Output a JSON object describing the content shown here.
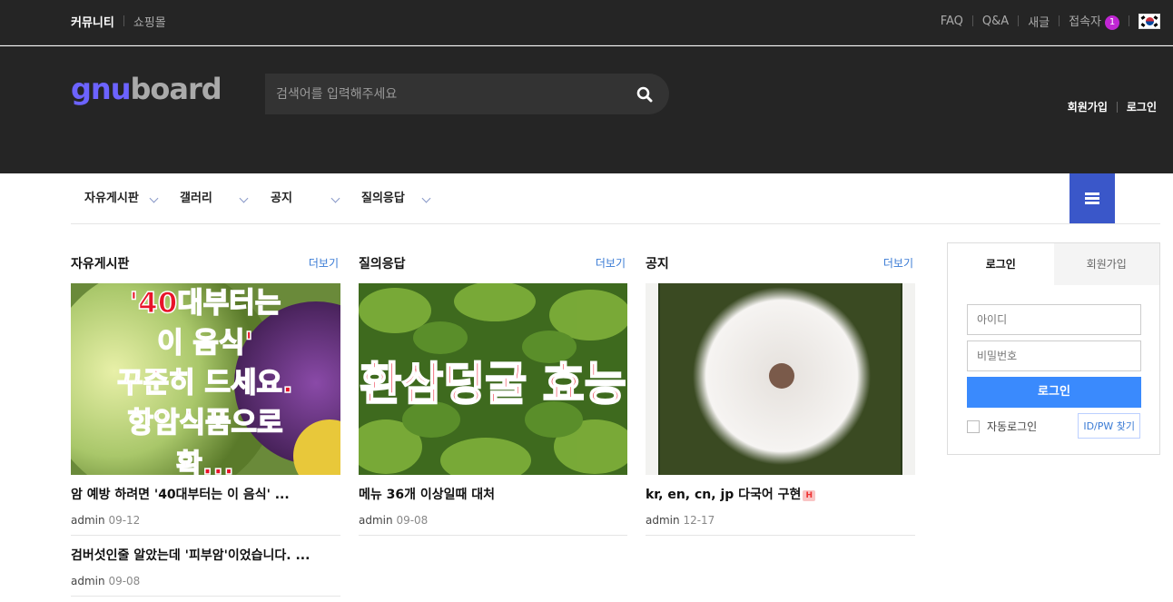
{
  "topbar": {
    "community": "커뮤니티",
    "shop": "쇼핑몰",
    "faq": "FAQ",
    "qa": "Q&A",
    "new": "새글",
    "visitors": "접속자",
    "visitors_count": "1"
  },
  "header": {
    "logo_part1": "gnu",
    "logo_part2": "board",
    "search_placeholder": "검색어를 입력해주세요",
    "join": "회원가입",
    "login": "로그인"
  },
  "nav": {
    "items": [
      "자유게시판",
      "갤러리",
      "공지",
      "질의응답"
    ]
  },
  "sections": [
    {
      "title": "자유게시판",
      "more": "더보기",
      "thumb_text": [
        "'40대부터는",
        "이 음식'",
        "꾸준히 드세요.",
        "항암식품으로",
        "확..."
      ],
      "posts": [
        {
          "title": "암 예방 하려면 '40대부터는 이 음식' ...",
          "author": "admin",
          "date": "09-12"
        },
        {
          "title": "검버섯인줄 알았는데 '피부암'이었습니다. ...",
          "author": "admin",
          "date": "09-08"
        }
      ]
    },
    {
      "title": "질의응답",
      "more": "더보기",
      "thumb_text": [
        "환삼덩굴 효능"
      ],
      "posts": [
        {
          "title": "메뉴 36개 이상일때 대처",
          "author": "admin",
          "date": "09-08"
        }
      ]
    },
    {
      "title": "공지",
      "more": "더보기",
      "posts": [
        {
          "title": "kr, en, cn, jp 다국어 구현",
          "badge": "H",
          "author": "admin",
          "date": "12-17"
        }
      ]
    }
  ],
  "login": {
    "tab_login": "로그인",
    "tab_join": "회원가입",
    "id_placeholder": "아이디",
    "pw_placeholder": "비밀번호",
    "submit": "로그인",
    "auto": "자동로그인",
    "find": "ID/PW 찾기"
  },
  "colors": {
    "dark_bg": "#252525",
    "accent_blue": "#3a57c9",
    "login_btn": "#3a8afd",
    "badge_purple": "#c026d3"
  }
}
